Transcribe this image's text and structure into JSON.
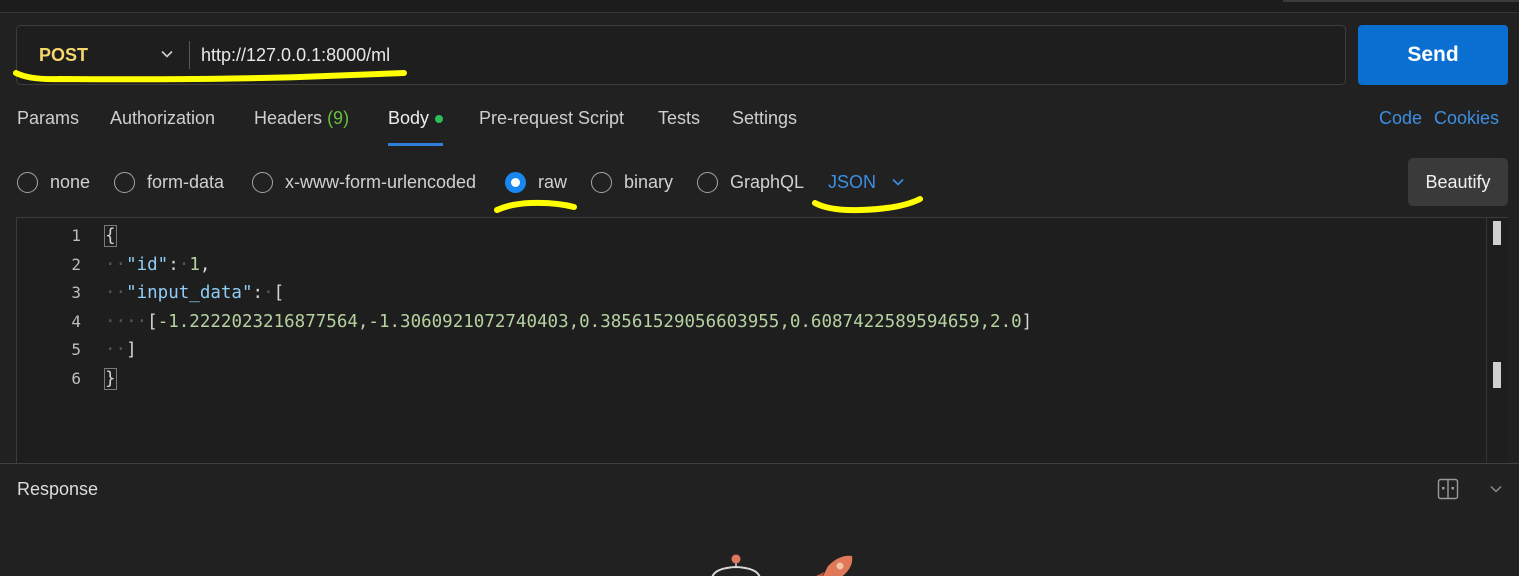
{
  "request": {
    "method": "POST",
    "url": "http://127.0.0.1:8000/ml",
    "send_label": "Send"
  },
  "tabs": [
    {
      "label": "Params"
    },
    {
      "label": "Authorization"
    },
    {
      "label": "Headers",
      "count": "(9)"
    },
    {
      "label": "Body",
      "active": true
    },
    {
      "label": "Pre-request Script"
    },
    {
      "label": "Tests"
    },
    {
      "label": "Settings"
    }
  ],
  "links": {
    "code": "Code",
    "cookies": "Cookies"
  },
  "body_types": [
    {
      "label": "none"
    },
    {
      "label": "form-data"
    },
    {
      "label": "x-www-form-urlencoded"
    },
    {
      "label": "raw",
      "selected": true
    },
    {
      "label": "binary"
    },
    {
      "label": "GraphQL"
    }
  ],
  "raw_format": "JSON",
  "beautify_label": "Beautify",
  "editor": {
    "line_numbers": [
      "1",
      "2",
      "3",
      "4",
      "5",
      "6"
    ],
    "lines": [
      "{",
      "  \"id\": 1,",
      "  \"input_data\": [",
      "    [-1.2222023216877564,-1.3060921072740403,0.38561529056603955,0.6087422589594659,2.0]",
      "  ]",
      "}"
    ],
    "tokens": {
      "open_brace": "{",
      "id_key": "\"id\"",
      "colon": ":",
      "id_value": "1",
      "comma": ",",
      "input_key": "\"input_data\"",
      "open_bracket": "[",
      "row_open": "[",
      "row_values": "-1.2222023216877564,-1.3060921072740403,0.38561529056603955,0.6087422589594659,2.0",
      "row_close": "]",
      "close_bracket": "]",
      "close_brace": "}"
    }
  },
  "response": {
    "title": "Response"
  },
  "colors": {
    "method": "#f5d76e",
    "send": "#0b6fd1",
    "accent_link": "#3c8fe4",
    "highlighter": "#ffff00",
    "json_key": "#8fcdf5",
    "json_number": "#b5d1a0"
  },
  "icons": [
    "chevron-down-icon",
    "radio-icon",
    "split-layout-icon",
    "collapse-chevron-icon",
    "astronaut-icon",
    "rocket-icon"
  ]
}
